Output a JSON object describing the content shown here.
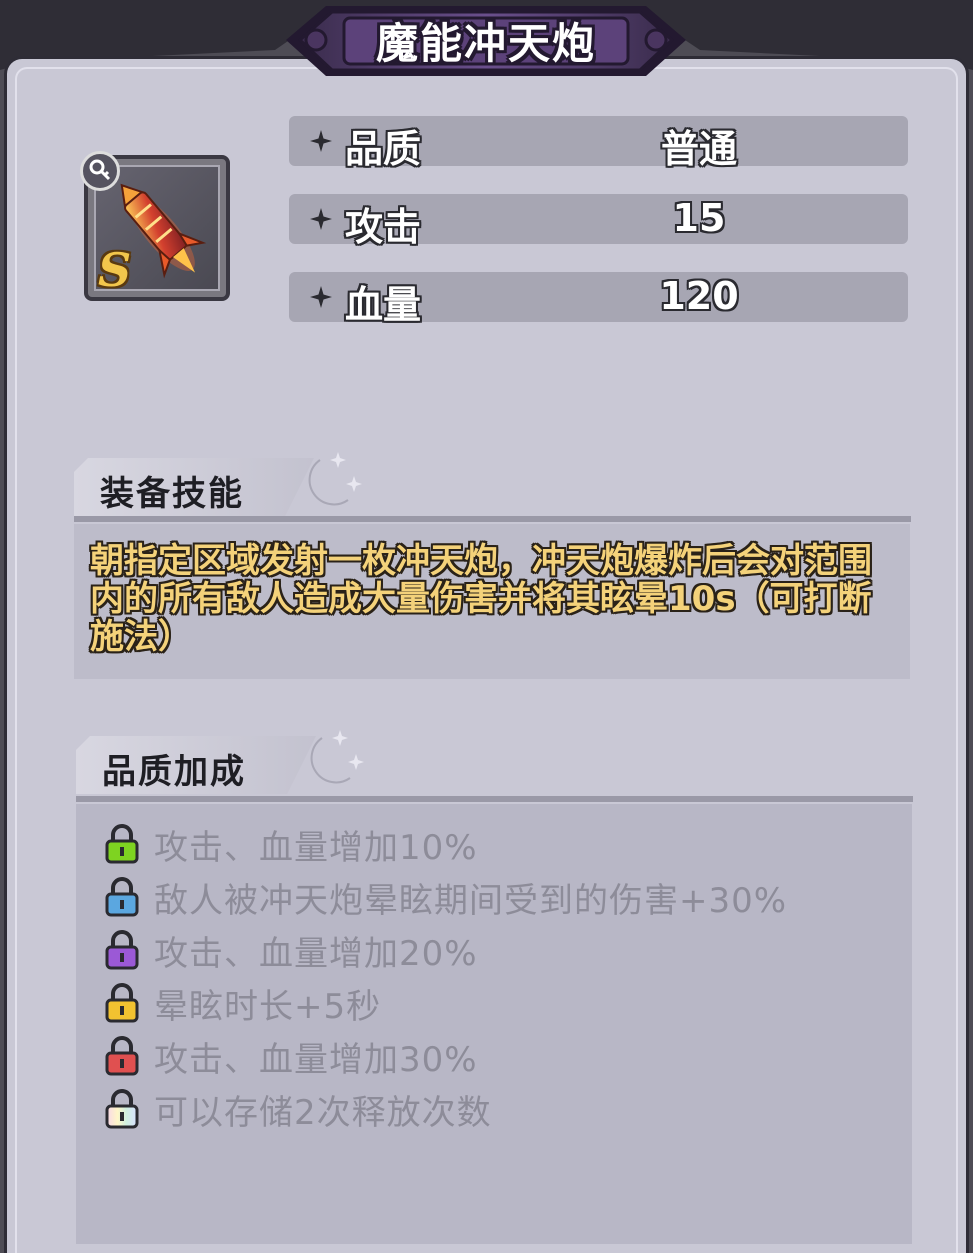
{
  "title": "魔能冲天炮",
  "item": {
    "grade": "S",
    "icon": "firework-rocket-icon",
    "badge_icon": "key-icon"
  },
  "stats": [
    {
      "label": "品质",
      "value": "普通"
    },
    {
      "label": "攻击",
      "value": "15"
    },
    {
      "label": "血量",
      "value": "120"
    }
  ],
  "skill": {
    "heading": "装备技能",
    "description": "朝指定区域发射一枚冲天炮，冲天炮爆炸后会对范围内的所有敌人造成大量伤害并将其眩晕10s（可打断施法）"
  },
  "bonus": {
    "heading": "品质加成",
    "items": [
      {
        "text": "攻击、血量增加10%",
        "lock_color": "#7ed321"
      },
      {
        "text": "敌人被冲天炮晕眩期间受到的伤害+30%",
        "lock_color": "#5ba7e0"
      },
      {
        "text": "攻击、血量增加20%",
        "lock_color": "#9b59d6"
      },
      {
        "text": "晕眩时长+5秒",
        "lock_color": "#f2c230"
      },
      {
        "text": "攻击、血量增加30%",
        "lock_color": "#e05050"
      },
      {
        "text": "可以存储2次释放次数",
        "lock_color": "rainbow"
      }
    ]
  }
}
